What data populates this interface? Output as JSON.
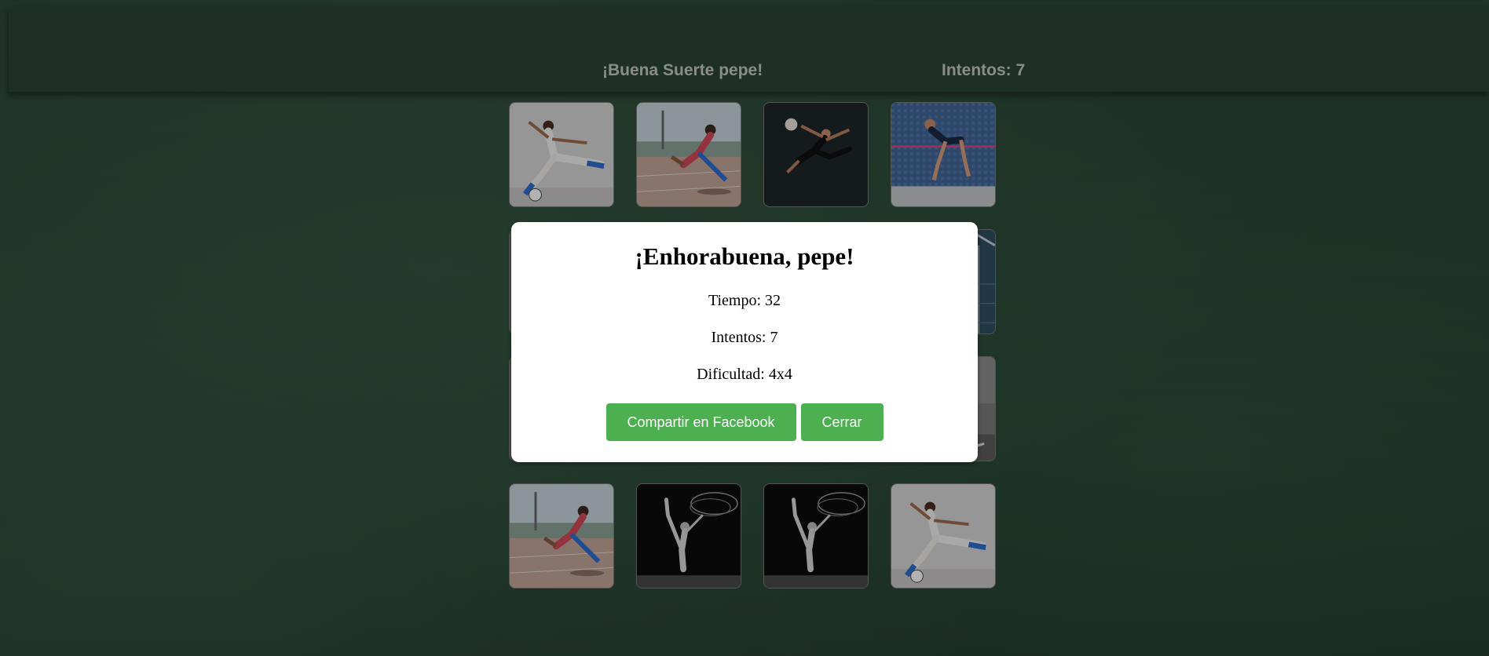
{
  "header": {
    "greeting": "¡Buena Suerte pepe!",
    "attempts": "Intentos: 7"
  },
  "board": {
    "difficulty": "4x4",
    "cards": [
      {
        "image": "soccer-girl-kick-icon"
      },
      {
        "image": "sprinter-track-icon"
      },
      {
        "image": "volleyball-spike-icon"
      },
      {
        "image": "high-jump-icon"
      },
      {
        "image": "hidden-card"
      },
      {
        "image": "hidden-card"
      },
      {
        "image": "hidden-card"
      },
      {
        "image": "pole-vault-icon"
      },
      {
        "image": "hidden-card"
      },
      {
        "image": "hidden-card"
      },
      {
        "image": "hidden-card"
      },
      {
        "image": "gym-court-icon"
      },
      {
        "image": "sprinter-track-icon"
      },
      {
        "image": "rhythmic-gymnast-icon"
      },
      {
        "image": "rhythmic-gymnast-icon"
      },
      {
        "image": "soccer-girl-kick-icon"
      }
    ]
  },
  "modal": {
    "title": "¡Enhorabuena, pepe!",
    "time": "Tiempo: 32",
    "attempts": "Intentos: 7",
    "difficulty": "Dificultad: 4x4",
    "share_label": "Compartir en Facebook",
    "close_label": "Cerrar"
  },
  "colors": {
    "background": "#2a4536",
    "button": "#4caf50",
    "header_text": "#c4c9c6"
  }
}
